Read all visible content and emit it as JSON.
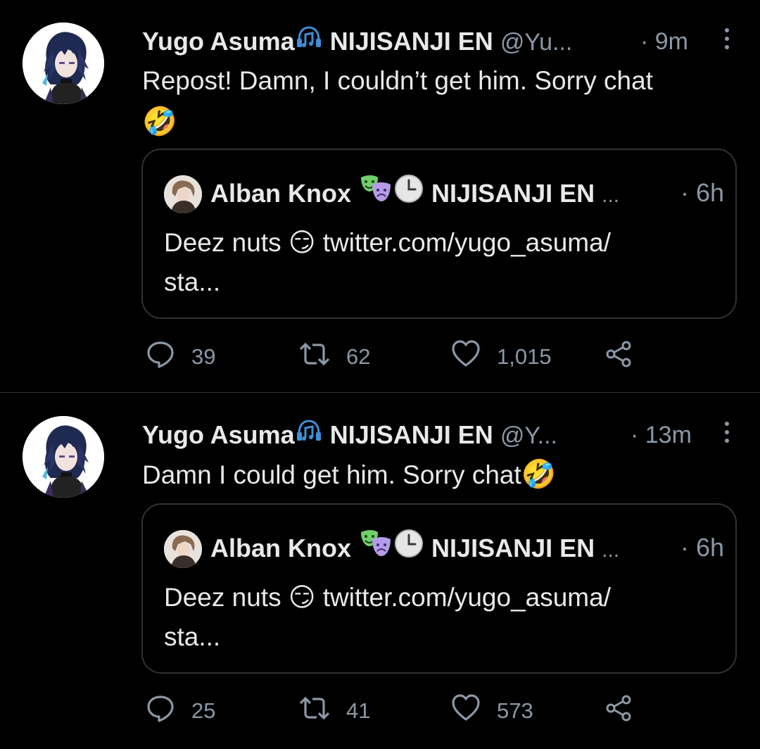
{
  "tweets": [
    {
      "author_name": "Yugo Asuma",
      "author_org": "NIJISANJI EN",
      "handle": "@Yu...",
      "time": "· 9m",
      "text": "Repost! Damn, I couldn’t get him. Sorry chat",
      "text_emoji": "🤣",
      "quote": {
        "author_name": "Alban Knox",
        "author_org": "NIJISANJI EN",
        "ellipsis": "...",
        "time": "· 6h",
        "text_start": "Deez nuts",
        "text_emoji": "😏",
        "text_link": "twitter.com/yugo_asuma/",
        "text_end": "sta..."
      },
      "reply_count": "39",
      "retweet_count": "62",
      "like_count": "1,015"
    },
    {
      "author_name": "Yugo Asuma",
      "author_org": "NIJISANJI EN",
      "handle": "@Y...",
      "time": "· 13m",
      "text": "Damn I could get him. Sorry chat",
      "text_emoji": "🤣",
      "quote": {
        "author_name": "Alban Knox",
        "author_org": "NIJISANJI EN",
        "ellipsis": "...",
        "time": "· 6h",
        "text_start": "Deez nuts",
        "text_emoji": "😏",
        "text_link": "twitter.com/yugo_asuma/",
        "text_end": "sta..."
      },
      "reply_count": "25",
      "retweet_count": "41",
      "like_count": "573"
    }
  ],
  "icons": {
    "name_badge": "headphones-music-icon",
    "quote_badge_1": "theater-masks-icon",
    "quote_badge_2": "clock-icon",
    "reply": "reply-icon",
    "retweet": "retweet-icon",
    "like": "heart-icon",
    "share": "share-icon",
    "more": "more-vertical-icon"
  },
  "colors": {
    "background": "#000000",
    "text_primary": "#e7e9ea",
    "text_secondary": "#8b98a5",
    "divider": "#2f3336",
    "badge_blue": "#3f8fd8"
  }
}
